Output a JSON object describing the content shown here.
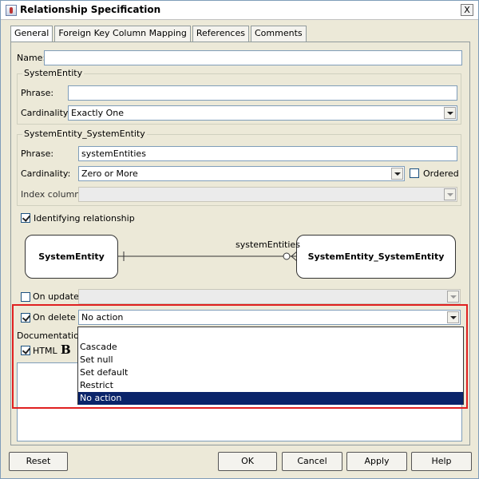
{
  "window": {
    "title": "Relationship Specification",
    "close_symbol": "X"
  },
  "tabs": [
    "General",
    "Foreign Key Column Mapping",
    "References",
    "Comments"
  ],
  "name": {
    "label": "Name:",
    "value": ""
  },
  "group1": {
    "title": "SystemEntity",
    "phrase_label": "Phrase:",
    "phrase_value": "",
    "cardinality_label": "Cardinality:",
    "cardinality_value": "Exactly One"
  },
  "group2": {
    "title": "SystemEntity_SystemEntity",
    "phrase_label": "Phrase:",
    "phrase_value": "systemEntities",
    "cardinality_label": "Cardinality:",
    "cardinality_value": "Zero or More",
    "ordered_label": "Ordered",
    "ordered_checked": false,
    "index_label": "Index column:",
    "index_value": ""
  },
  "identifying": {
    "label": "Identifying relationship",
    "checked": true
  },
  "diagram": {
    "left_entity": "SystemEntity",
    "right_entity": "SystemEntity_SystemEntity",
    "phrase": "systemEntities"
  },
  "on_update": {
    "label": "On update",
    "checked": false,
    "value": ""
  },
  "on_delete": {
    "label": "On delete",
    "checked": true,
    "value": "No action",
    "options": [
      "Cascade",
      "Set null",
      "Set default",
      "Restrict",
      "No action"
    ],
    "selected": "No action"
  },
  "documentation": {
    "label": "Documentation:",
    "html_label": "HTML",
    "html_checked": true,
    "bold_symbol": "B"
  },
  "buttons": {
    "reset": "Reset",
    "ok": "OK",
    "cancel": "Cancel",
    "apply": "Apply",
    "help": "Help"
  },
  "colors": {
    "selection": "#0a246a",
    "highlight": "#e02020"
  }
}
